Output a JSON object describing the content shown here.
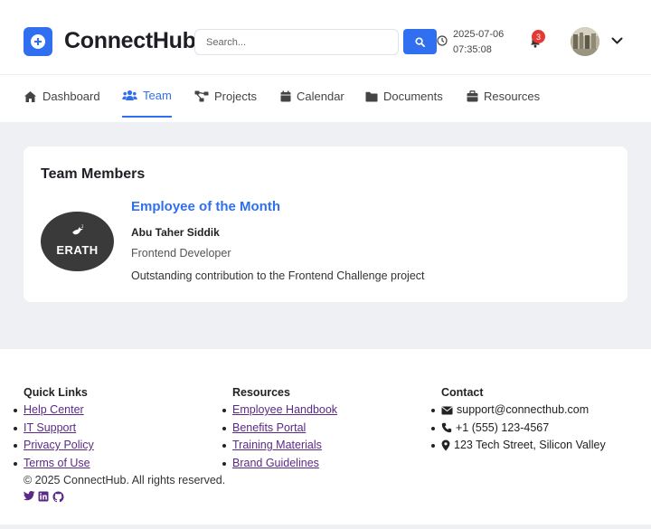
{
  "header": {
    "app_title": "ConnectHub",
    "search_placeholder": "Search...",
    "date": "2025-07-06",
    "time": "07:35:08",
    "notification_count": "3"
  },
  "nav": {
    "tabs": [
      {
        "label": "Dashboard",
        "icon": "home-icon"
      },
      {
        "label": "Team",
        "icon": "users-icon",
        "active": true
      },
      {
        "label": "Projects",
        "icon": "project-diagram-icon"
      },
      {
        "label": "Calendar",
        "icon": "calendar-icon"
      },
      {
        "label": "Documents",
        "icon": "folder-icon"
      },
      {
        "label": "Resources",
        "icon": "briefcase-icon"
      }
    ]
  },
  "team": {
    "title": "Team Members",
    "featured": {
      "heading": "Employee of the Month",
      "name": "Abu Taher Siddik",
      "role": "Frontend Developer",
      "note": "Outstanding contribution to the Frontend Challenge project",
      "image_text": "ERATH"
    }
  },
  "footer": {
    "quick_links": {
      "title": "Quick Links",
      "items": [
        "Help Center",
        "IT Support",
        "Privacy Policy",
        "Terms of Use"
      ]
    },
    "resources": {
      "title": "Resources",
      "items": [
        "Employee Handbook",
        "Benefits Portal",
        "Training Materials",
        "Brand Guidelines"
      ]
    },
    "contact": {
      "title": "Contact",
      "email": "support@connecthub.com",
      "phone": "+1 (555) 123-4567",
      "address": "123 Tech Street, Silicon Valley"
    },
    "copyright": "© 2025 ConnectHub. All rights reserved."
  },
  "colors": {
    "accent": "#2f6ff0",
    "badge": "#e53935",
    "link": "#5b2a86",
    "background": "#eef0f3"
  }
}
